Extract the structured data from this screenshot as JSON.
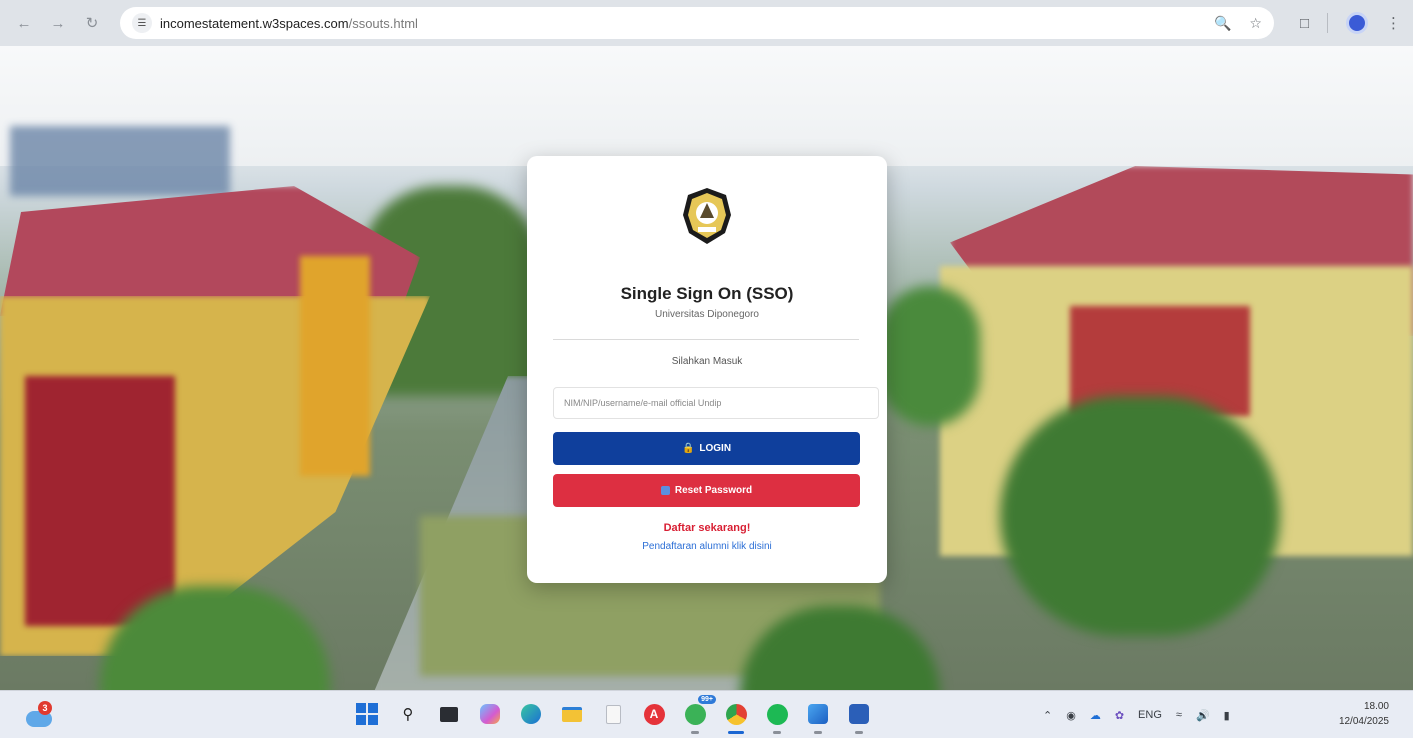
{
  "browser": {
    "url_domain": "incomestatement.w3spaces.com",
    "url_path": "/ssouts.html"
  },
  "login": {
    "title": "Single Sign On (SSO)",
    "subtitle": "Universitas Diponegoro",
    "prompt": "Silahkan Masuk",
    "username_placeholder": "NIM/NIP/username/e-mail official Undip",
    "login_label": "LOGIN",
    "reset_label": "Reset Password",
    "register_text": "Daftar sekarang!",
    "alumni_text": "Pendaftaran alumni klik disini"
  },
  "taskbar": {
    "weather_badge": "3",
    "copilot_badge": "99+",
    "language": "ENG",
    "time": "18.00",
    "date": "12/04/2025"
  },
  "colors": {
    "login_button": "#0f3f9c",
    "reset_button": "#dd2f41",
    "register_link": "#d81f33",
    "alumni_link": "#2c6fd6"
  }
}
